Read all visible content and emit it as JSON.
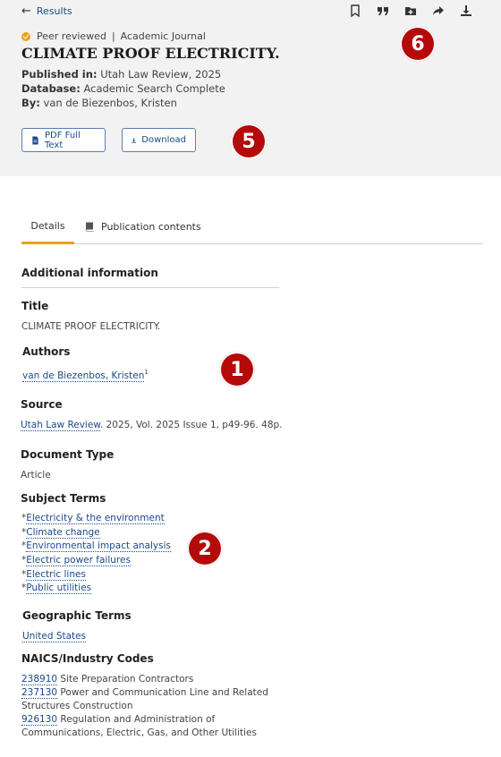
{
  "nav": {
    "back_label": "Results"
  },
  "toolbar": {
    "icons": [
      "bookmark-icon",
      "cite-icon",
      "folder-add-icon",
      "share-icon",
      "download-icon"
    ]
  },
  "record": {
    "peer_reviewed": "Peer reviewed",
    "journal_type": "Academic Journal",
    "title": "CLIMATE PROOF ELECTRICITY.",
    "published_label": "Published in:",
    "published_value": "Utah Law Review, 2025",
    "database_label": "Database:",
    "database_value": "Academic Search Complete",
    "by_label": "By:",
    "by_value": "van de Biezenbos, Kristen"
  },
  "actions": {
    "pdf_label": "PDF Full Text",
    "download_label": "Download"
  },
  "tabs": [
    {
      "label": "Details"
    },
    {
      "label": "Publication contents"
    }
  ],
  "details": {
    "heading": "Additional information",
    "title_label": "Title",
    "title_value": "CLIMATE PROOF ELECTRICITY.",
    "authors_label": "Authors",
    "author_name": "van de Biezenbos, Kristen",
    "author_sup": "1",
    "source_label": "Source",
    "source_link": "Utah Law Review",
    "source_rest": ". 2025, Vol. 2025 Issue 1, p49-96. 48p.",
    "doctype_label": "Document Type",
    "doctype_value": "Article",
    "subject_label": "Subject Terms",
    "subjects": [
      "Electricity & the environment",
      "Climate change",
      "Environmental impact analysis",
      "Electric power failures",
      "Electric lines",
      "Public utilities"
    ],
    "geo_label": "Geographic Terms",
    "geo_value": "United States",
    "naics_label": "NAICS/Industry Codes",
    "naics": [
      {
        "code": "238910",
        "text": " Site Preparation Contractors"
      },
      {
        "code": "237130",
        "text": " Power and Communication Line and Related Structures Construction"
      },
      {
        "code": "926130",
        "text": " Regulation and Administration of Communications, Electric, Gas, and Other Utilities"
      }
    ]
  },
  "markers": {
    "m1": "1",
    "m2": "2",
    "m5": "5",
    "m6": "6"
  },
  "colors": {
    "accent": "#e8a21c",
    "link": "#1a4a8a",
    "marker": "#b50a0a",
    "header_bg": "#f2f2f2"
  }
}
